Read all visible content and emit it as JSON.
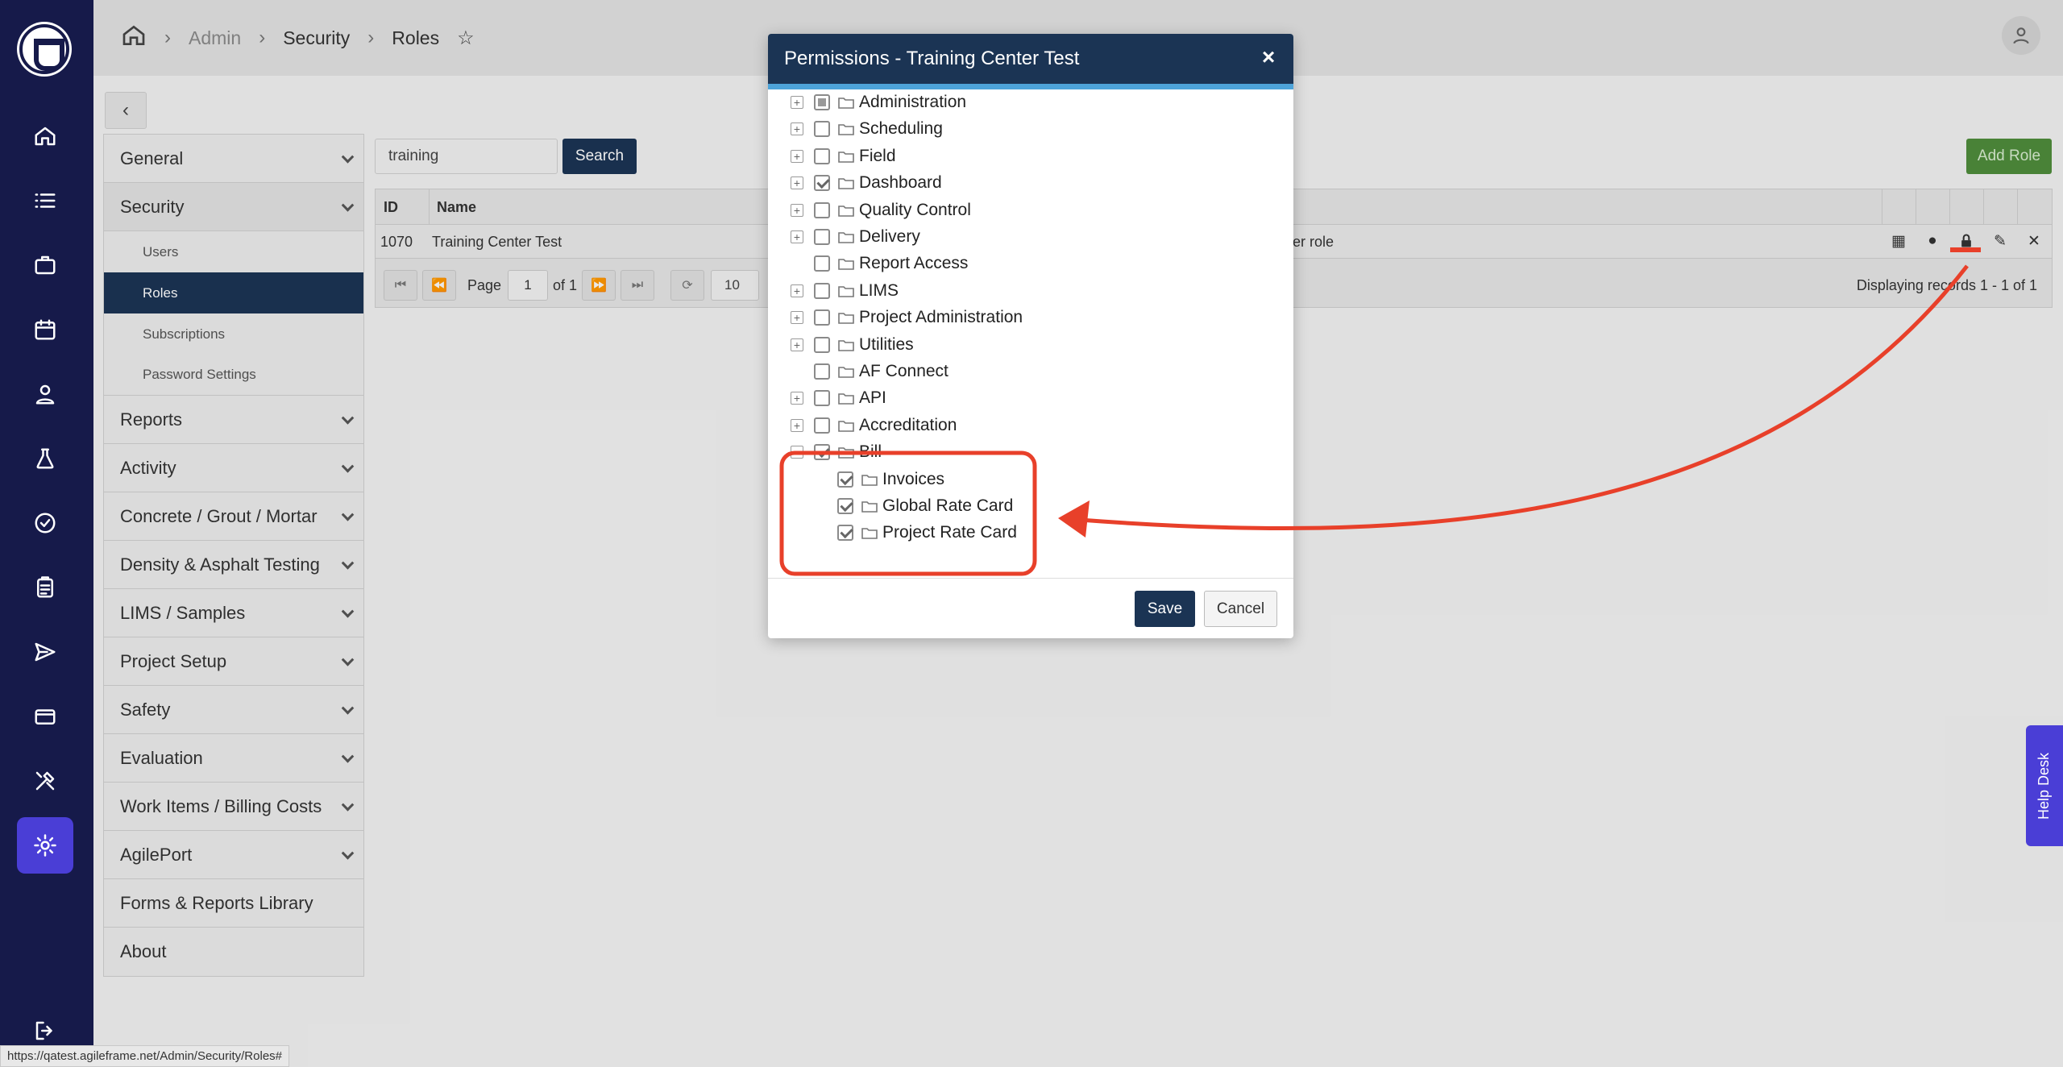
{
  "status_url": "https://qatest.agileframe.net/Admin/Security/Roles#",
  "breadcrumb": [
    "Admin",
    "Security",
    "Roles"
  ],
  "subnav": {
    "items": [
      {
        "label": "General"
      },
      {
        "label": "Security"
      },
      {
        "label": "Reports"
      },
      {
        "label": "Activity"
      },
      {
        "label": "Concrete / Grout / Mortar"
      },
      {
        "label": "Density & Asphalt Testing"
      },
      {
        "label": "LIMS / Samples"
      },
      {
        "label": "Project Setup"
      },
      {
        "label": "Safety"
      },
      {
        "label": "Evaluation"
      },
      {
        "label": "Work Items / Billing Costs"
      },
      {
        "label": "AgilePort"
      },
      {
        "label": "Forms & Reports Library"
      },
      {
        "label": "About"
      }
    ],
    "security_sub": [
      "Users",
      "Roles",
      "Subscriptions",
      "Password Settings"
    ]
  },
  "search": {
    "value": "training",
    "button": "Search"
  },
  "add_role": "Add Role",
  "grid": {
    "columns": [
      "ID",
      "Name"
    ],
    "row": {
      "id": "1070",
      "name": "Training Center Test",
      "desc_fragment": "er role"
    },
    "pager": {
      "page_label": "Page",
      "page": "1",
      "of_label": "of 1",
      "page_size": "10"
    },
    "displaying": "Displaying records 1 - 1 of 1"
  },
  "modal": {
    "title": "Permissions - Training Center Test",
    "close": "×",
    "tree": [
      {
        "label": "Administration",
        "toggle": "+",
        "state": "partial"
      },
      {
        "label": "Scheduling",
        "toggle": "+",
        "state": "unchecked"
      },
      {
        "label": "Field",
        "toggle": "+",
        "state": "unchecked"
      },
      {
        "label": "Dashboard",
        "toggle": "+",
        "state": "checked"
      },
      {
        "label": "Quality Control",
        "toggle": "+",
        "state": "unchecked"
      },
      {
        "label": "Delivery",
        "toggle": "+",
        "state": "unchecked"
      },
      {
        "label": "Report Access",
        "toggle": "",
        "state": "unchecked"
      },
      {
        "label": "LIMS",
        "toggle": "+",
        "state": "unchecked"
      },
      {
        "label": "Project Administration",
        "toggle": "+",
        "state": "unchecked"
      },
      {
        "label": "Utilities",
        "toggle": "+",
        "state": "unchecked"
      },
      {
        "label": "AF Connect",
        "toggle": "",
        "state": "unchecked"
      },
      {
        "label": "API",
        "toggle": "+",
        "state": "unchecked"
      },
      {
        "label": "Accreditation",
        "toggle": "+",
        "state": "unchecked"
      },
      {
        "label": "Bill",
        "toggle": "−",
        "state": "checked"
      }
    ],
    "bill_children": [
      {
        "label": "Invoices",
        "state": "checked"
      },
      {
        "label": "Global Rate Card",
        "state": "checked"
      },
      {
        "label": "Project Rate Card",
        "state": "checked"
      }
    ],
    "save": "Save",
    "cancel": "Cancel"
  },
  "helpdesk": "Help Desk",
  "colors": {
    "nav_bg": "#161a4a",
    "accent": "#4a3ed6",
    "primary": "#1b3454",
    "annotation": "#e8402a",
    "add_role": "#4f8c3c"
  }
}
